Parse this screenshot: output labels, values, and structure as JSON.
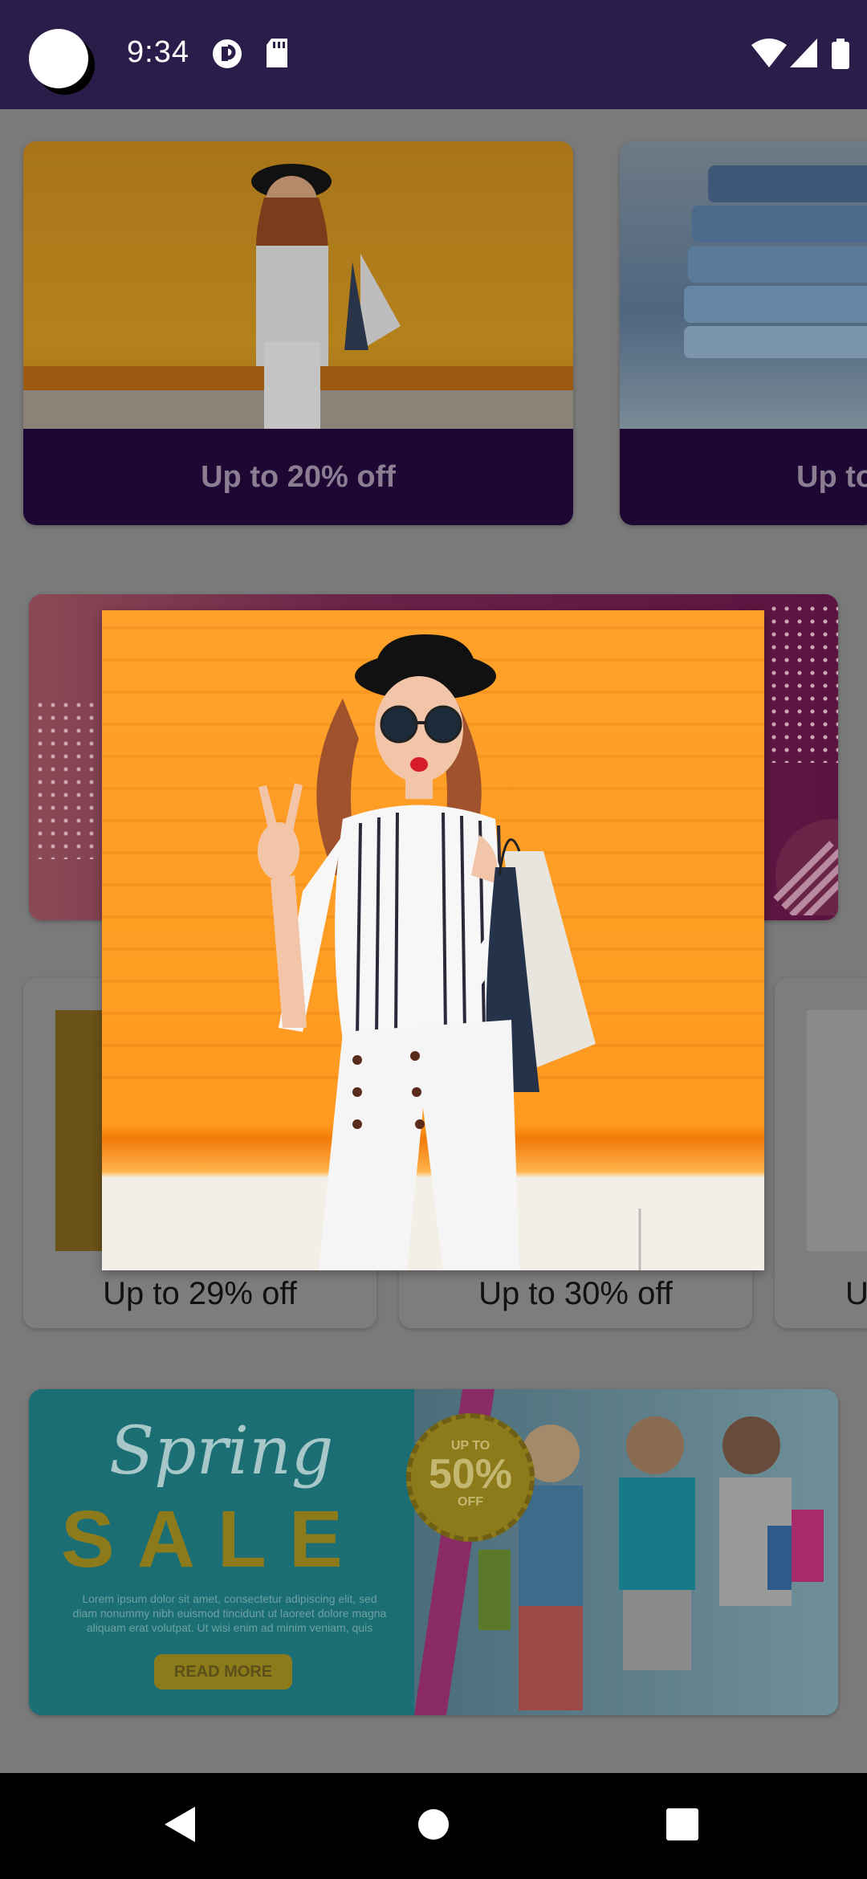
{
  "status_bar": {
    "time": "9:34",
    "icons": [
      "pocket-icon",
      "sdcard-icon",
      "wifi-icon",
      "signal-icon",
      "battery-icon"
    ]
  },
  "cards_top": [
    {
      "label": "Up to 20% off"
    },
    {
      "label": "Up to"
    }
  ],
  "cards_small": [
    {
      "label": "Up to 29% off"
    },
    {
      "label": "Up to 30% off"
    },
    {
      "label": "U"
    }
  ],
  "spring_banner": {
    "title_script": "Spring",
    "title_sale": "SALE",
    "badge_top": "UP TO",
    "badge_value": "50%",
    "badge_bottom": "OFF",
    "lorem": "Lorem ipsum dolor sit amet, consectetur adipiscing elit, sed diam nonummy nibh euismod tincidunt ut laoreet dolore magna aliquam erat volutpat. Ut wisi enim ad minim veniam, quis",
    "read_more": "READ MORE"
  },
  "popup": {
    "subject": "woman-shopping-bags-photo"
  },
  "nav_bar": {
    "buttons": [
      "back-icon",
      "home-icon",
      "recents-icon"
    ]
  },
  "colors": {
    "status_bar": "#2a1d4a",
    "card_band": "#1f0734",
    "popup_orange": "#ff9a1f"
  }
}
